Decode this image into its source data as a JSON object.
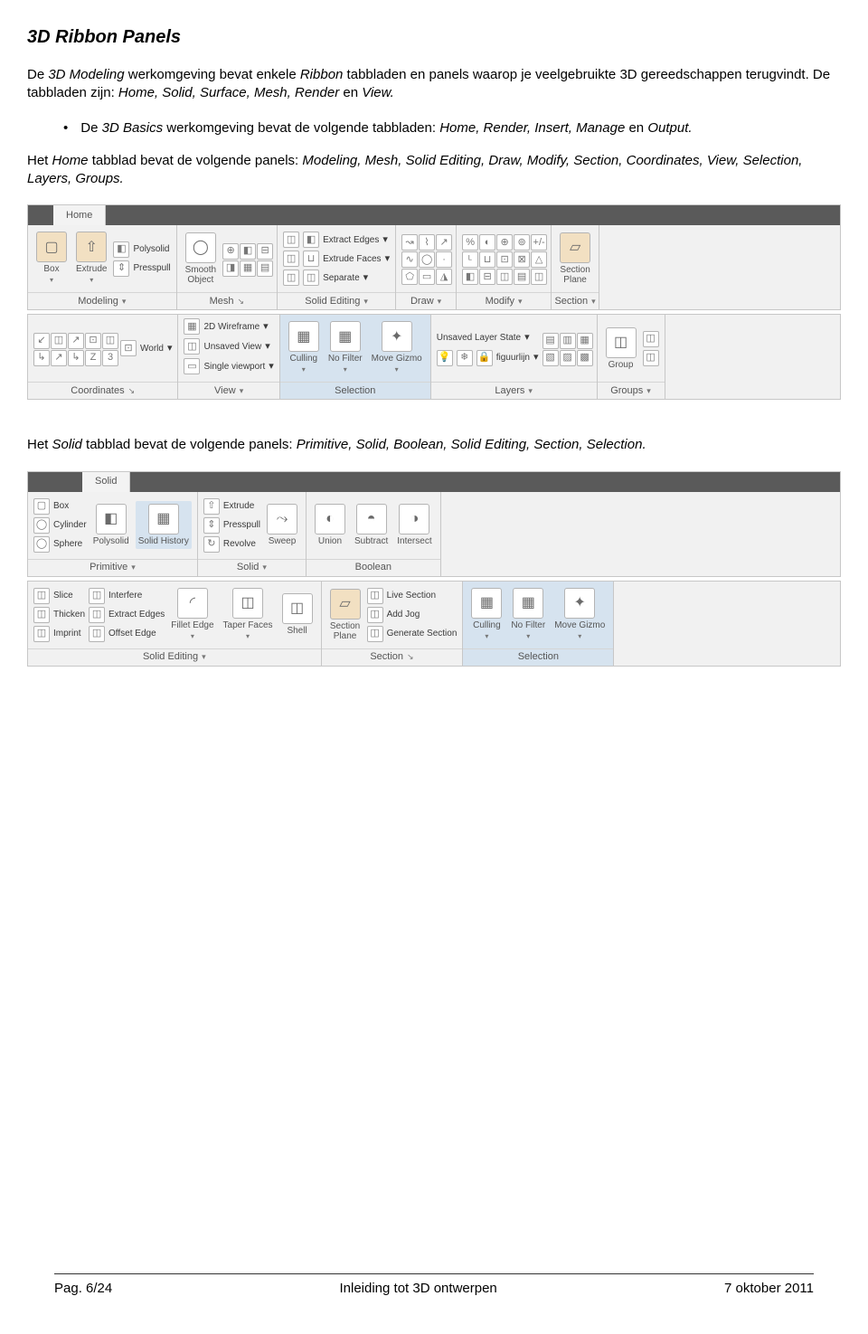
{
  "title": "3D Ribbon Panels",
  "p1_a": "De ",
  "p1_b": "3D Modeling",
  "p1_c": " werkomgeving bevat enkele ",
  "p1_d": "Ribbon",
  "p1_e": " tabbladen en panels waarop je veelgebruikte 3D gereedschappen terugvindt. De tabbladen zijn: ",
  "p1_f": "Home, Solid, Surface, Mesh, Render",
  "p1_g": " en ",
  "p1_h": "View.",
  "b1_a": "De ",
  "b1_b": "3D Basics",
  "b1_c": " werkomgeving bevat de volgende tabbladen: ",
  "b1_d": "Home, Render, Insert, Manage",
  "b1_e": " en ",
  "b1_f": "Output.",
  "p2_a": "Het ",
  "p2_b": "Home",
  "p2_c": " tabblad bevat de volgende panels: ",
  "p2_d": "Modeling, Mesh, Solid Editing, Draw, Modify, Section, Coordinates, View, Selection, Layers, Groups.",
  "p3_a": "Het ",
  "p3_b": "Solid",
  "p3_c": " tabblad bevat de volgende panels: ",
  "p3_d": "Primitive, Solid, Boolean, Solid Editing, Section, Selection.",
  "home_tab": "Home",
  "solid_tab": "Solid",
  "ribbon1": {
    "panels": [
      "Modeling",
      "Mesh",
      "Solid Editing",
      "Draw",
      "Modify",
      "Section"
    ],
    "box": "Box",
    "extrude": "Extrude",
    "polysolid": "Polysolid",
    "presspull": "Presspull",
    "smooth": "Smooth\nObject",
    "extract_edges": "Extract Edges",
    "extrude_faces": "Extrude Faces",
    "separate": "Separate",
    "section_plane": "Section\nPlane"
  },
  "ribbon2": {
    "panels": [
      "Coordinates",
      "View",
      "Selection",
      "Layers",
      "Groups"
    ],
    "wireframe": "2D Wireframe",
    "unsaved_view": "Unsaved View",
    "single_vp": "Single viewport",
    "world": "World",
    "culling": "Culling",
    "nofilter": "No Filter",
    "movegizmo": "Move Gizmo",
    "layerstate": "Unsaved Layer State",
    "layer": "figuurlijn",
    "group": "Group"
  },
  "ribbon3": {
    "panels": [
      "Primitive",
      "Solid",
      "Boolean"
    ],
    "box": "Box",
    "cylinder": "Cylinder",
    "sphere": "Sphere",
    "polysolid": "Polysolid",
    "solidhist": "Solid History",
    "extrude": "Extrude",
    "presspull": "Presspull",
    "revolve": "Revolve",
    "sweep": "Sweep",
    "union": "Union",
    "subtract": "Subtract",
    "intersect": "Intersect"
  },
  "ribbon4": {
    "panels": [
      "Solid Editing",
      "Section",
      "Selection"
    ],
    "slice": "Slice",
    "thicken": "Thicken",
    "imprint": "Imprint",
    "interfere": "Interfere",
    "extract_edges": "Extract Edges",
    "offset_edge": "Offset Edge",
    "fillet": "Fillet Edge",
    "taper": "Taper Faces",
    "shell": "Shell",
    "section_plane": "Section\nPlane",
    "live_section": "Live Section",
    "add_jog": "Add Jog",
    "gen_section": "Generate Section",
    "culling": "Culling",
    "nofilter": "No Filter",
    "movegizmo": "Move Gizmo"
  },
  "footer": {
    "page": "Pag. 6/24",
    "title": "Inleiding tot 3D ontwerpen",
    "date": "7 oktober 2011"
  }
}
